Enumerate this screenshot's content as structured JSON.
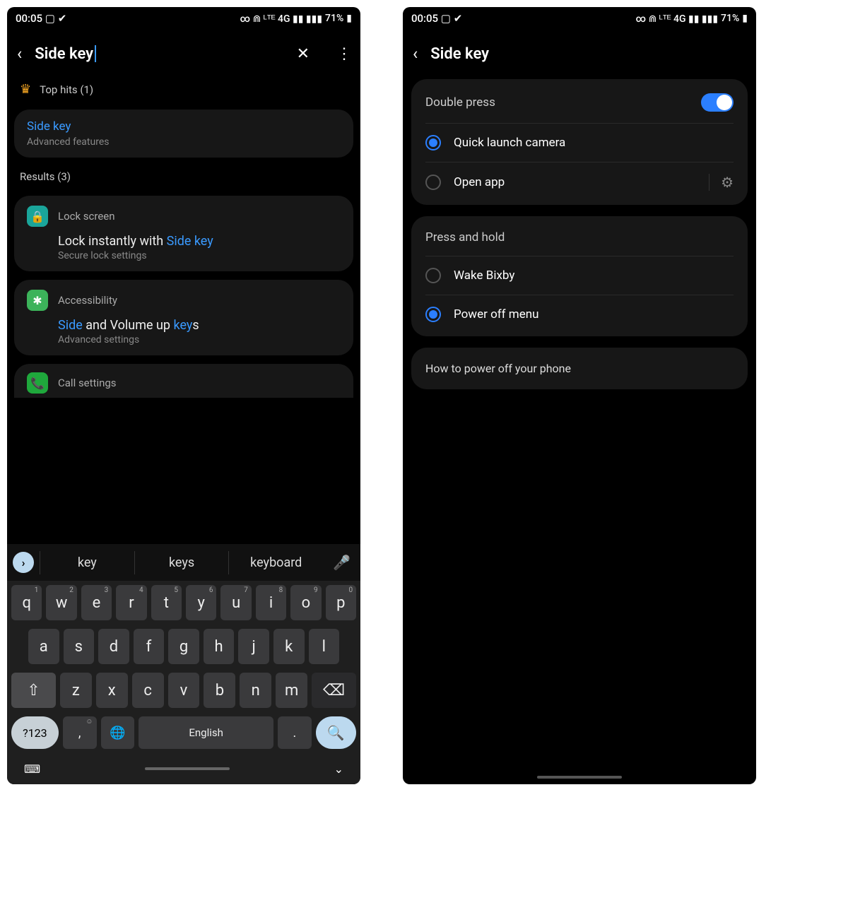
{
  "status": {
    "time": "00:05",
    "left_icons": "▢ ✔",
    "right_text": "71%",
    "right_icons": "∞ ⋒ ᴸᵀᴱ 4G ▮▮ ▮▮▮"
  },
  "left": {
    "search_value": "Side key",
    "top_hits_label": "Top hits (1)",
    "top_hit": {
      "title": "Side key",
      "path": "Advanced features"
    },
    "results_label": "Results (3)",
    "results": [
      {
        "category": "Lock screen",
        "title_pre": "Lock instantly with ",
        "title_hl": "Side key",
        "title_post": "",
        "sub": "Secure lock settings"
      },
      {
        "category": "Accessibility",
        "title_pre": "",
        "title_hl": "Side",
        "title_mid": " and Volume up ",
        "title_hl2": "key",
        "title_post": "s",
        "sub": "Advanced settings"
      },
      {
        "category": "Call settings"
      }
    ],
    "suggestions": [
      "key",
      "keys",
      "keyboard"
    ],
    "keyboard": {
      "row1": [
        "q",
        "w",
        "e",
        "r",
        "t",
        "y",
        "u",
        "i",
        "o",
        "p"
      ],
      "row1_nums": [
        "1",
        "2",
        "3",
        "4",
        "5",
        "6",
        "7",
        "8",
        "9",
        "0"
      ],
      "row2": [
        "a",
        "s",
        "d",
        "f",
        "g",
        "h",
        "j",
        "k",
        "l"
      ],
      "row3": [
        "z",
        "x",
        "c",
        "v",
        "b",
        "n",
        "m"
      ],
      "space": "English",
      "numkey": "?123"
    }
  },
  "right": {
    "title": "Side key",
    "double_press": {
      "label": "Double press",
      "options": [
        {
          "label": "Quick launch camera",
          "checked": true,
          "gear": false
        },
        {
          "label": "Open app",
          "checked": false,
          "gear": true
        }
      ]
    },
    "press_hold": {
      "label": "Press and hold",
      "options": [
        {
          "label": "Wake Bixby",
          "checked": false
        },
        {
          "label": "Power off menu",
          "checked": true
        }
      ]
    },
    "help_link": "How to power off your phone"
  }
}
